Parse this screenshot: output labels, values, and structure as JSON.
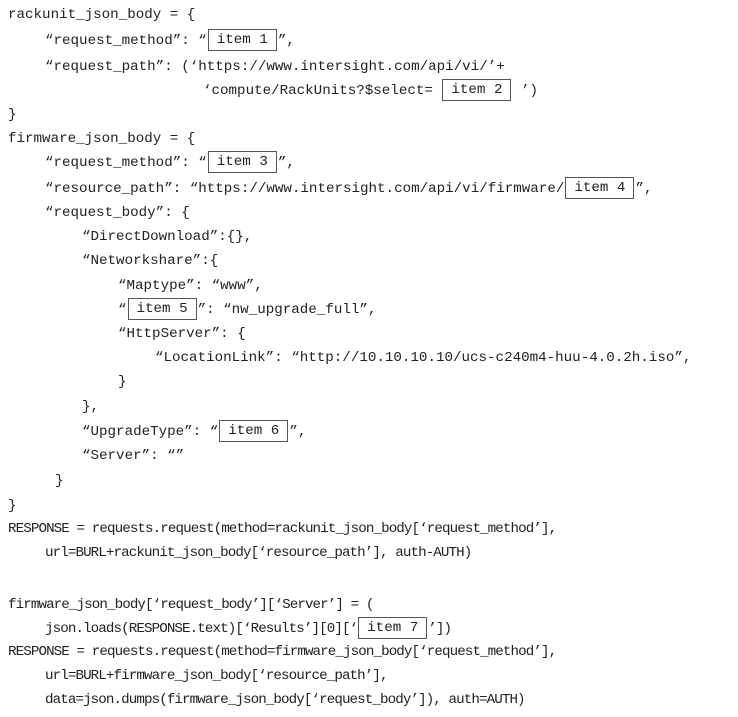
{
  "code": {
    "rackunit_block": {
      "open": "rackunit_json_body = {",
      "request_method_prefix": "“request_method”: “",
      "request_method_suffix": "”,",
      "request_path_prefix": "“request_path”: (‘https://www.intersight.com/api/vi/’+",
      "request_path_cont_prefix": "‘compute/RackUnits?$select= ",
      "request_path_cont_suffix": " ’)",
      "close": "}"
    },
    "firmware_block": {
      "open": "firmware_json_body = {",
      "request_method_prefix": "“request_method”: “",
      "request_method_suffix": "”,",
      "resource_path_prefix": "“resource_path”: “https://www.intersight.com/api/vi/firmware/",
      "resource_path_suffix": "”,",
      "request_body_open": "“request_body”: {",
      "direct_download": "“DirectDownload”:{},",
      "networkshare_open": "“Networkshare”:{",
      "maptype": "“Maptype”: “www”,",
      "item5_prefix": "“",
      "item5_suffix": "”: “nw_upgrade_full”,",
      "httpserver_open": "“HttpServer”: {",
      "location_link": "“LocationLink”: “http://10.10.10.10/ucs-c240m4-huu-4.0.2h.iso”,",
      "httpserver_close": "}",
      "networkshare_close": "},",
      "upgrade_type_prefix": "“UpgradeType”: “",
      "upgrade_type_suffix": "”,",
      "server": "“Server”: “”",
      "request_body_close": "}",
      "close": "}"
    },
    "calls": {
      "response1_line1": "RESPONSE = requests.request(method=rackunit_json_body[‘request_method’],",
      "response1_line2": "url=BURL+rackunit_json_body[‘resource_path’], auth-AUTH)",
      "server_assign_line1": "firmware_json_body[‘request_body’][‘Server’] = (",
      "server_assign_line2_prefix": "json.loads(RESPONSE.text)[‘Results’][0][‘",
      "server_assign_line2_suffix": "’])",
      "response2_line1": "RESPONSE = requests.request(method=firmware_json_body[‘request_method’],",
      "response2_line2": "url=BURL+firmware_json_body[‘resource_path’],",
      "response2_line3": "data=json.dumps(firmware_json_body[‘request_body’]), auth=AUTH)"
    },
    "blanks": {
      "item1": "item 1",
      "item2": "item 2",
      "item3": "item 3",
      "item4": "item 4",
      "item5": "item 5",
      "item6": "item 6",
      "item7": "item 7"
    }
  }
}
